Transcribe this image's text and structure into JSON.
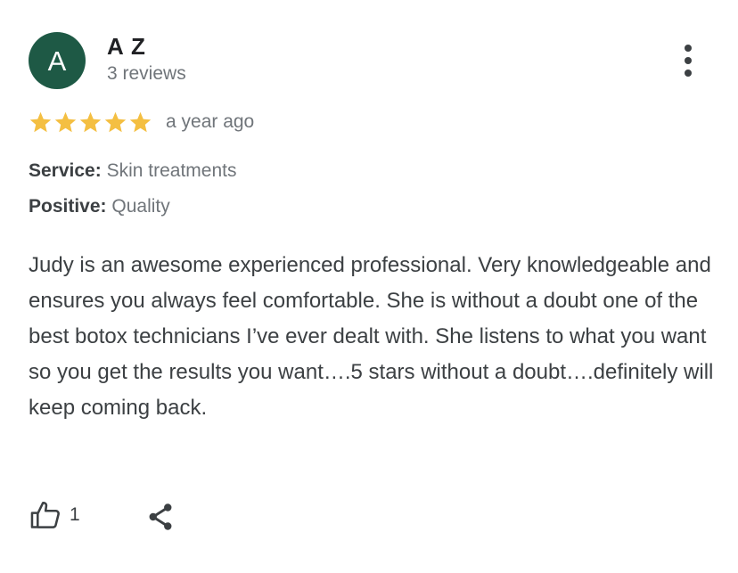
{
  "review": {
    "author": {
      "initial": "A",
      "name": "A Z",
      "meta": "3 reviews",
      "avatar_color": "#1e5945"
    },
    "rating": {
      "value": 5,
      "max": 5,
      "color": "#f4bf42"
    },
    "time": "a year ago",
    "attributes": [
      {
        "label": "Service:",
        "value": "Skin treatments"
      },
      {
        "label": "Positive:",
        "value": "Quality"
      }
    ],
    "text": "Judy is an awesome experienced professional. Very knowledgeable and ensures you always feel comfortable. She is without a doubt one of the best botox technicians I’ve ever dealt with. She listens to what you want so you get the results you want….5 stars without a doubt….definitely will keep coming back.",
    "actions": {
      "like_count": "1",
      "like_icon": "thumb-up-icon",
      "share_icon": "share-icon",
      "more_icon": "more-vert-icon"
    }
  }
}
